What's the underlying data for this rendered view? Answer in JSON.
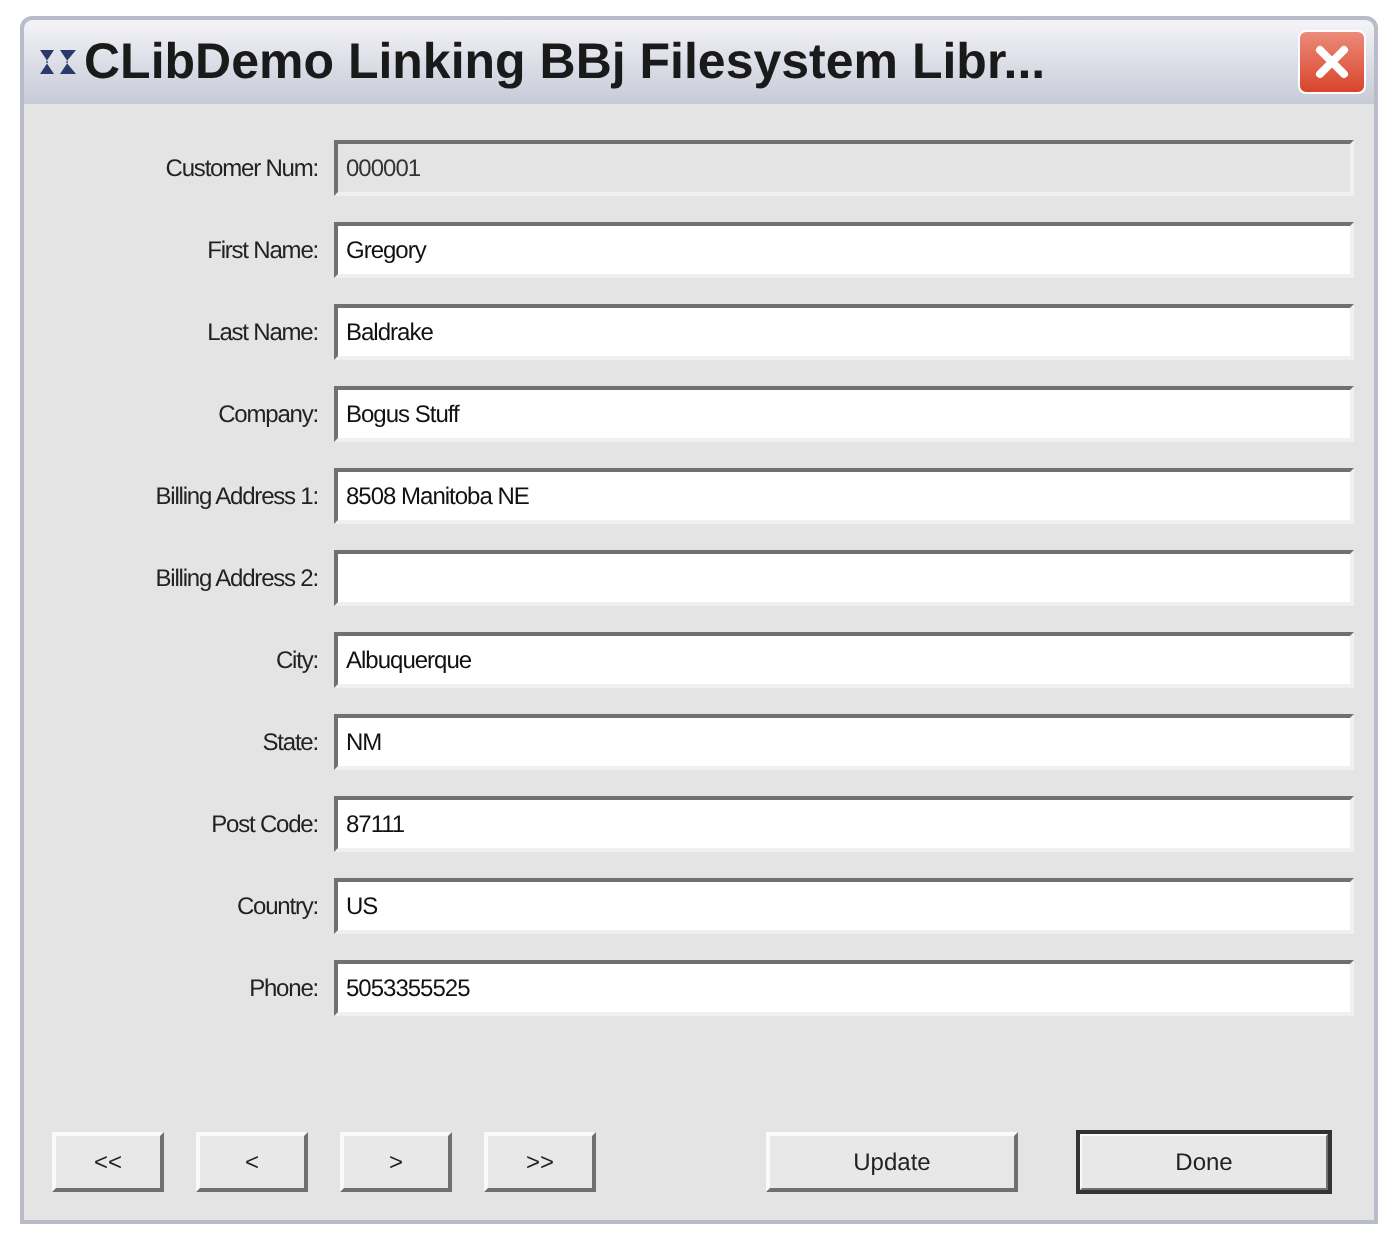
{
  "window": {
    "title": "CLibDemo Linking BBj Filesystem Libr..."
  },
  "fields": [
    {
      "label": "Customer Num:",
      "value": "000001",
      "disabled": true
    },
    {
      "label": "First Name:",
      "value": "Gregory",
      "disabled": false
    },
    {
      "label": "Last Name:",
      "value": "Baldrake",
      "disabled": false
    },
    {
      "label": "Company:",
      "value": "Bogus Stuff",
      "disabled": false
    },
    {
      "label": "Billing Address 1:",
      "value": "8508 Manitoba NE",
      "disabled": false
    },
    {
      "label": "Billing Address 2:",
      "disabled": false
    },
    {
      "label": "City:",
      "value": "Albuquerque",
      "disabled": false
    },
    {
      "label": "State:",
      "value": "NM",
      "disabled": false
    },
    {
      "label": "Post Code:",
      "value": "87111",
      "disabled": false
    },
    {
      "label": "Country:",
      "value": "US",
      "disabled": false
    },
    {
      "label": "Phone:",
      "value": "5053355525",
      "disabled": false
    }
  ],
  "nav_buttons": [
    "<<",
    "<",
    ">",
    ">>"
  ],
  "buttons": [
    {
      "label": "Update",
      "default": false
    },
    {
      "label": "Done",
      "default": true
    }
  ]
}
